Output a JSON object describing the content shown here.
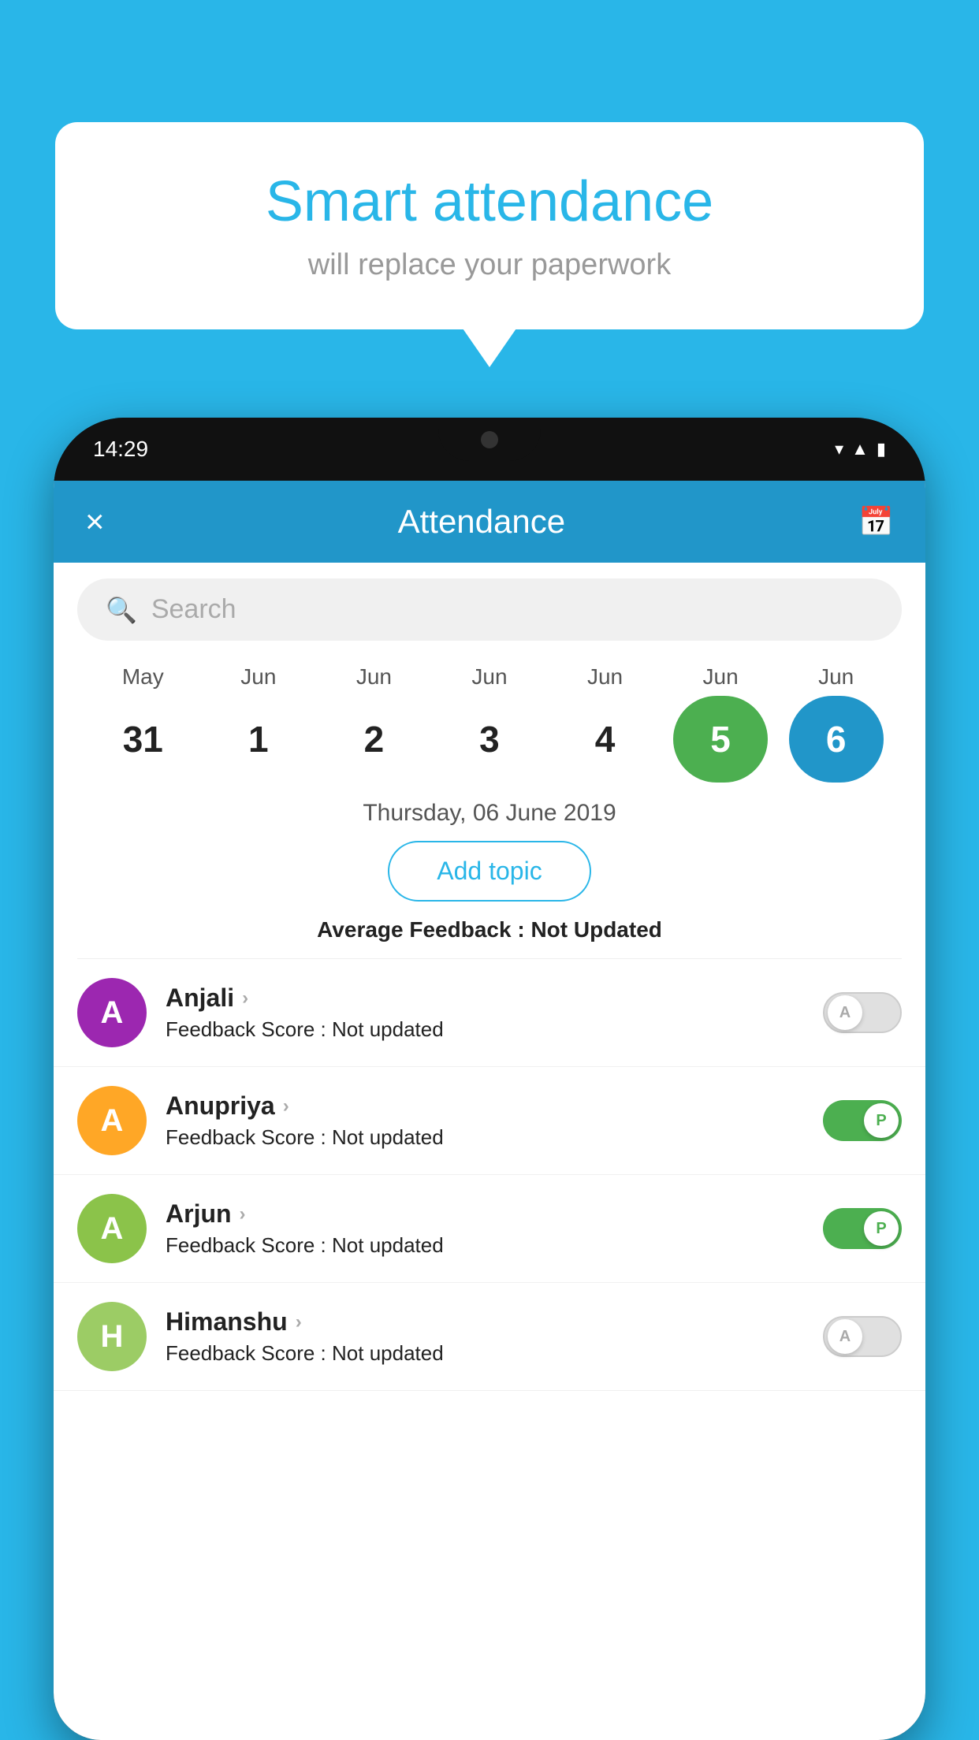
{
  "background_color": "#29b6e8",
  "speech_bubble": {
    "title": "Smart attendance",
    "subtitle": "will replace your paperwork"
  },
  "phone": {
    "time": "14:29",
    "header": {
      "title": "Attendance",
      "close_label": "×",
      "calendar_icon": "calendar-icon"
    },
    "search": {
      "placeholder": "Search"
    },
    "calendar": {
      "months": [
        "May",
        "Jun",
        "Jun",
        "Jun",
        "Jun",
        "Jun",
        "Jun"
      ],
      "days": [
        "31",
        "1",
        "2",
        "3",
        "4",
        "5",
        "6"
      ],
      "selected_today": "5",
      "selected_current": "6"
    },
    "date_label": "Thursday, 06 June 2019",
    "add_topic_button": "Add topic",
    "avg_feedback_label": "Average Feedback :",
    "avg_feedback_value": "Not Updated",
    "students": [
      {
        "name": "Anjali",
        "avatar_letter": "A",
        "avatar_color": "#9c27b0",
        "feedback_label": "Feedback Score :",
        "feedback_value": "Not updated",
        "toggle_state": "off",
        "toggle_label": "A"
      },
      {
        "name": "Anupriya",
        "avatar_letter": "A",
        "avatar_color": "#ffa726",
        "feedback_label": "Feedback Score :",
        "feedback_value": "Not updated",
        "toggle_state": "on",
        "toggle_label": "P"
      },
      {
        "name": "Arjun",
        "avatar_letter": "A",
        "avatar_color": "#8bc34a",
        "feedback_label": "Feedback Score :",
        "feedback_value": "Not updated",
        "toggle_state": "on",
        "toggle_label": "P"
      },
      {
        "name": "Himanshu",
        "avatar_letter": "H",
        "avatar_color": "#9ccc65",
        "feedback_label": "Feedback Score :",
        "feedback_value": "Not updated",
        "toggle_state": "off",
        "toggle_label": "A"
      }
    ]
  }
}
